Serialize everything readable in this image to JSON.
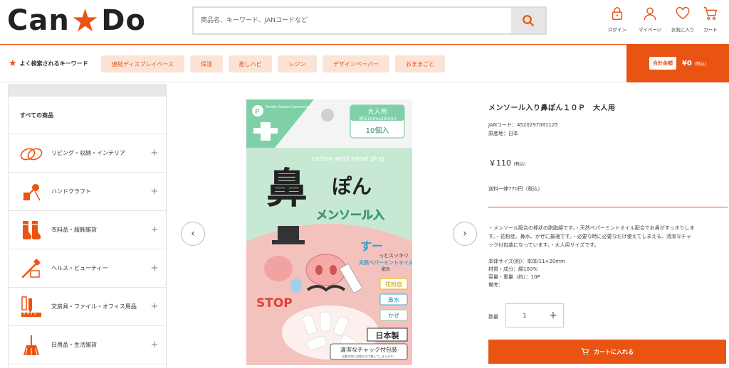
{
  "header": {
    "logo_left": "Can",
    "logo_right": "Do",
    "search_placeholder": "商品名、キーワード、JANコードなど",
    "icons": [
      {
        "name": "lock-icon",
        "label": "ログイン"
      },
      {
        "name": "user-icon",
        "label": "マイページ"
      },
      {
        "name": "heart-icon",
        "label": "お気に入り"
      },
      {
        "name": "cart-icon",
        "label": "カート"
      }
    ]
  },
  "keywords": {
    "title": "よく検索されるキーワード",
    "items": [
      "連結ディスプレイベース",
      "保湿",
      "推しハピ",
      "レジン",
      "デザインペーパー",
      "おままごと"
    ]
  },
  "total": {
    "label": "合計金額",
    "amount": "¥0",
    "tax": "(税込)"
  },
  "sidebar": {
    "all_label": "すべての商品",
    "items": [
      {
        "label": "リビング・収納・インテリア"
      },
      {
        "label": "ハンドクラフト"
      },
      {
        "label": "衣料品・服飾雑貨"
      },
      {
        "label": "ヘルス・ビューティー"
      },
      {
        "label": "文房具・ファイル・オフィス用品"
      },
      {
        "label": "日用品・生活雑貨"
      }
    ]
  },
  "product_image": {
    "brand": "Family Goods Communication",
    "size_badge_1": "大人用",
    "size_badge_2": "(約11mmx20mm)",
    "count_badge": "10個入",
    "english": "cotton wool nasal plug",
    "big_char": "鼻",
    "pon": "ぽん",
    "menthol": "メンソール入",
    "suu": "すー",
    "sukkiri": "っとスッキリ",
    "oil": "天然ペパーミントオイル",
    "oil2": "配合",
    "tag1": "花粉症",
    "tag2": "鼻水",
    "tag3": "かぜ",
    "stop": "STOP",
    "made": "日本製",
    "zipper": "清潔なチャック付包装",
    "zipper_sub": "必要な時に必要なだけ使えてしまえます。"
  },
  "product": {
    "title": "メンソール入り鼻ぽん１０Ｐ　大人用",
    "jan": "JANコード：4520297081125",
    "origin": "原産地：日本",
    "price": "￥110",
    "price_tax": "(税込)",
    "shipping": "送料一律770円（税込）",
    "desc_1": "・メンソール配合の棒状の脱脂綿です。・天然ペパーミントオイル配合でお鼻がすっきりしま",
    "desc_2": "す。・花粉症、鼻水、かぜに最適です。・必要な時に必要なだけ使えてしまえる、清潔なチャ",
    "desc_3": "ック付包装になっています。・大人用サイズです。",
    "spec_1": "本体サイズ(約)：本体/11×20mm",
    "spec_2": "材質・成分：綿100%",
    "spec_3": "容量・重量（約）：10P",
    "spec_4": "備考：",
    "qty_label": "数量",
    "qty_value": "1",
    "cart_button": "カートに入れる"
  },
  "colors": {
    "accent": "#ea5413",
    "chip_bg": "#fbe3d6",
    "package_green": "#bfe6cf",
    "package_pink": "#f5c6c2"
  }
}
